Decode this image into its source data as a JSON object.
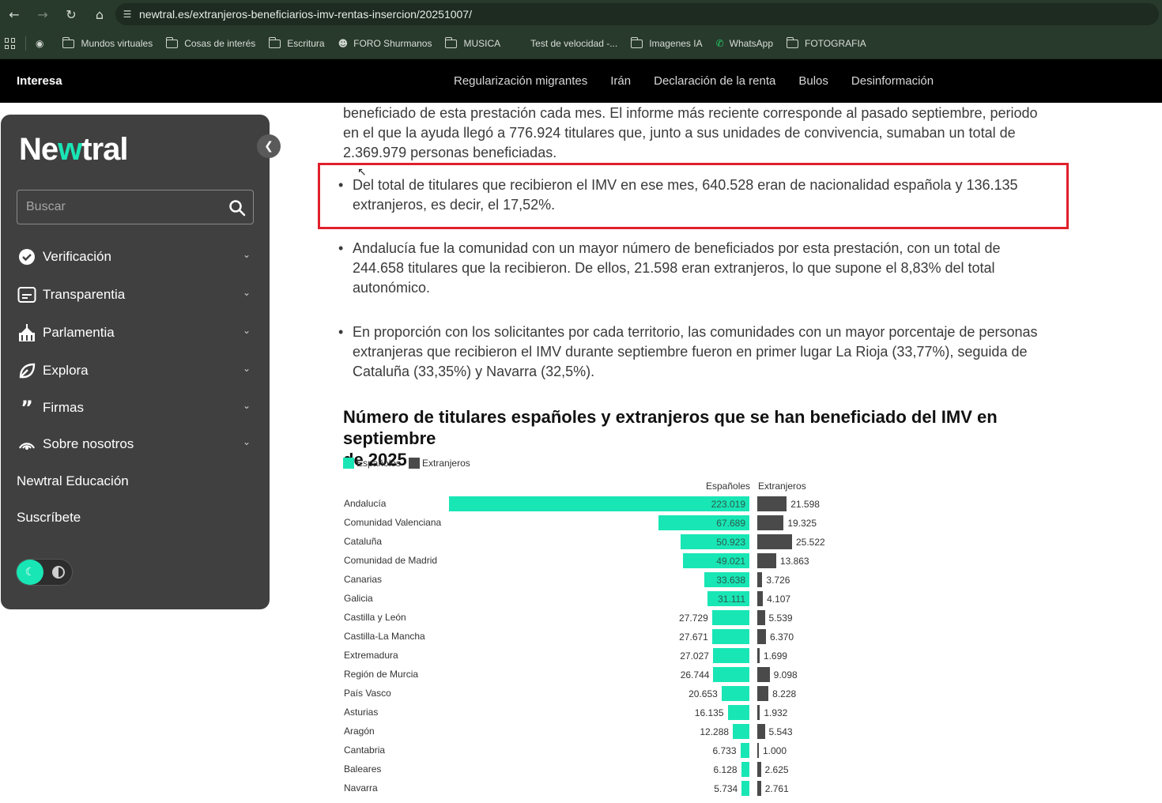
{
  "browser": {
    "url": "newtral.es/extranjeros-beneficiarios-imv-rentas-insercion/20251007/",
    "bookmarks": [
      "Mundos virtuales",
      "Cosas de interés",
      "Escritura",
      "FORO Shurmanos",
      "MUSICA",
      "Test de velocidad -...",
      "Imagenes IA",
      "WhatsApp",
      "FOTOGRAFIA"
    ]
  },
  "header": {
    "section": "Interesa",
    "nav": [
      "Regularización migrantes",
      "Irán",
      "Declaración de la renta",
      "Bulos",
      "Desinformación"
    ]
  },
  "sidebar": {
    "logo_a": "Ne",
    "logo_b": "w",
    "logo_c": "tral",
    "search_placeholder": "Buscar",
    "menu": [
      {
        "label": "Verificación",
        "icon": "verified-badge-icon"
      },
      {
        "label": "Transparentia",
        "icon": "transparency-screen-icon"
      },
      {
        "label": "Parlamentia",
        "icon": "parliament-building-icon"
      },
      {
        "label": "Explora",
        "icon": "leaf-explore-icon"
      },
      {
        "label": "Firmas",
        "icon": "quote-icon"
      },
      {
        "label": "Sobre nosotros",
        "icon": "broadcast-icon"
      },
      {
        "label": "Newtral Educación",
        "icon": ""
      },
      {
        "label": "Suscríbete",
        "icon": ""
      }
    ]
  },
  "article": {
    "intro_lines": [
      "beneficiado de esta prestación cada mes. El informe más reciente corresponde al pasado septiembre, periodo",
      "en el que la ayuda llegó a 776.924 titulares que, junto a sus unidades de convivencia, sumaban un total de",
      "2.369.979 personas beneficiadas."
    ],
    "bullets": [
      {
        "lines": [
          "Del total de titulares que recibieron el IMV en ese mes, 640.528 eran de nacionalidad española y 136.135",
          "extranjeros, es decir, el 17,52%."
        ]
      },
      {
        "lines": [
          "Andalucía fue la comunidad con un mayor número de beneficiados por esta prestación, con un total de",
          "244.658 titulares que la recibieron. De ellos, 21.598 eran extranjeros, lo que supone el 8,83% del total",
          "autonómico."
        ]
      },
      {
        "lines": [
          "En proporción con los solicitantes por cada territorio, las comunidades con un mayor porcentaje de personas",
          "extranjeras que recibieron el IMV durante septiembre fueron en primer lugar La Rioja (33,77%), seguida de",
          "Cataluña (33,35%) y Navarra (32,5%)."
        ]
      }
    ]
  },
  "chart_data": {
    "type": "bar",
    "title_lines": [
      "Número de titulares españoles y extranjeros que se han beneficiado del IMV en septiembre",
      "de 2025"
    ],
    "legend": [
      "Españoles",
      "Extranjeros"
    ],
    "column_headers": [
      "Españoles",
      "Extranjeros"
    ],
    "colors": {
      "espanoles": "#19e6b5",
      "extranjeros": "#4a4a4a"
    },
    "categories": [
      "Andalucía",
      "Comunidad Valenciana",
      "Cataluña",
      "Comunidad de Madrid",
      "Canarias",
      "Galicia",
      "Castilla y León",
      "Castilla-La Mancha",
      "Extremadura",
      "Región de Murcia",
      "País Vasco",
      "Asturias",
      "Aragón",
      "Cantabria",
      "Baleares",
      "Navarra"
    ],
    "series": [
      {
        "name": "Españoles",
        "values": [
          223019,
          67689,
          50923,
          49021,
          33638,
          31111,
          27729,
          27671,
          27027,
          26744,
          20653,
          16135,
          12288,
          6733,
          6128,
          5734
        ],
        "labels": [
          "223.019",
          "67.689",
          "50.923",
          "49.021",
          "33.638",
          "31.111",
          "27.729",
          "27.671",
          "27.027",
          "26.744",
          "20.653",
          "16.135",
          "12.288",
          "6.733",
          "6.128",
          "5.734"
        ]
      },
      {
        "name": "Extranjeros",
        "values": [
          21598,
          19325,
          25522,
          13863,
          3726,
          4107,
          5539,
          6370,
          1699,
          9098,
          8228,
          1932,
          5543,
          1000,
          2625,
          2761
        ],
        "labels": [
          "21.598",
          "19.325",
          "25.522",
          "13.863",
          "3.726",
          "4.107",
          "5.539",
          "6.370",
          "1.699",
          "9.098",
          "8.228",
          "1.932",
          "5.543",
          "1.000",
          "2.625",
          "2.761"
        ]
      }
    ]
  }
}
